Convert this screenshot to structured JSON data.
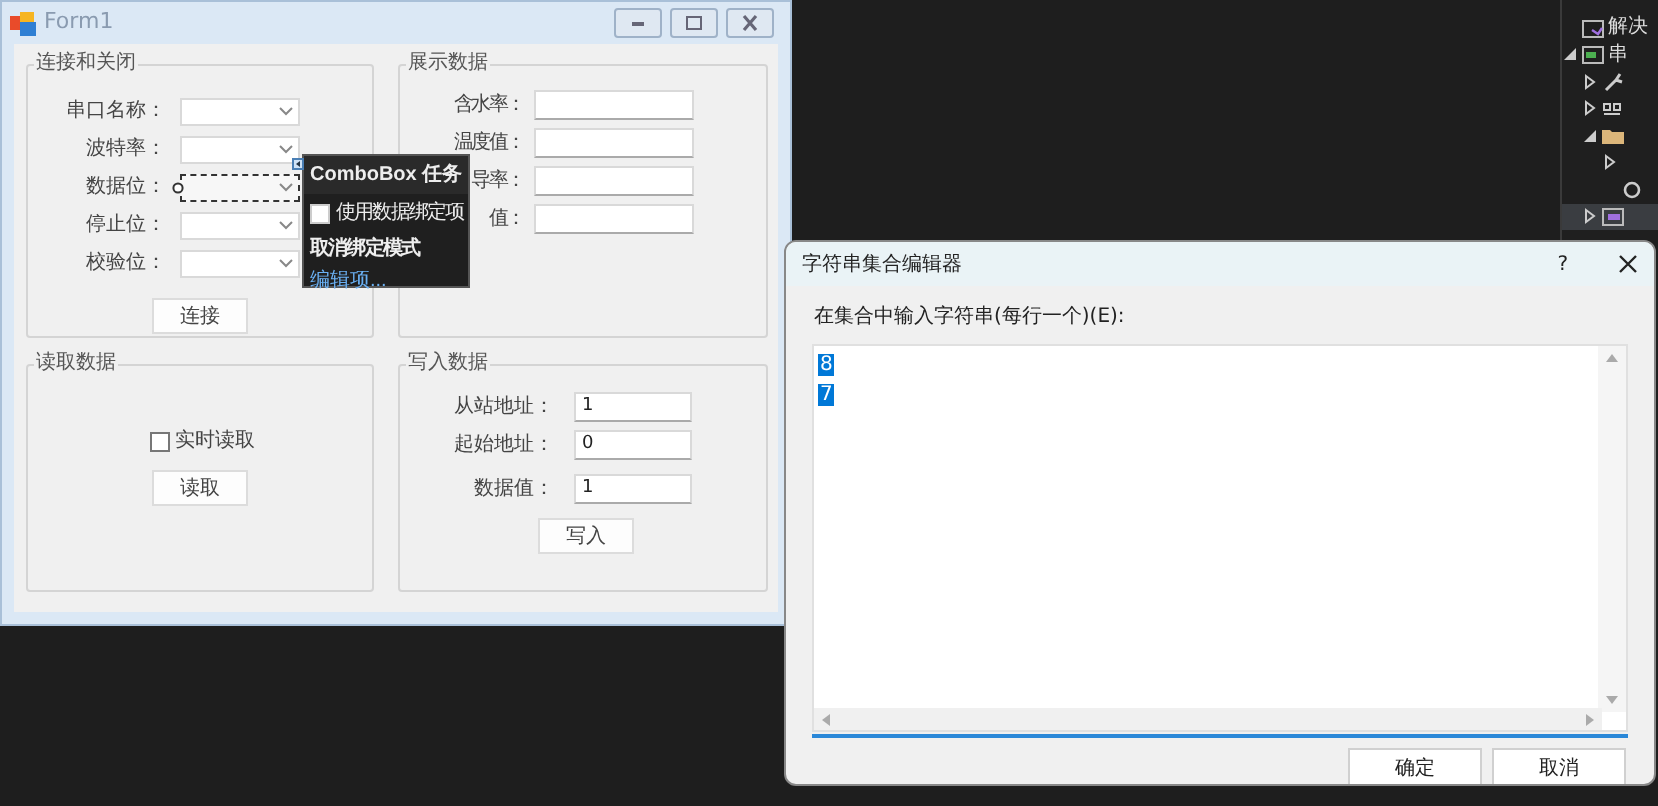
{
  "form": {
    "title": "Form1",
    "groups": [
      {
        "kind": "combos",
        "title": "连接和关闭",
        "fields": [
          {
            "label": "串口名称：",
            "selected": false
          },
          {
            "label": "波特率：",
            "selected": false
          },
          {
            "label": "数据位：",
            "selected": true
          },
          {
            "label": "停止位：",
            "selected": false
          },
          {
            "label": "校验位：",
            "selected": false
          }
        ],
        "button": "连接"
      },
      {
        "kind": "textboxes",
        "title": "展示数据",
        "fields": [
          {
            "label": "含水率："
          },
          {
            "label": "温度值："
          },
          {
            "label": "导率："
          },
          {
            "label": "值："
          }
        ]
      },
      {
        "kind": "read",
        "title": "读取数据",
        "checkbox": {
          "label": "实时读取",
          "checked": false
        },
        "button": "读取"
      },
      {
        "kind": "write",
        "title": "写入数据",
        "fields": [
          {
            "label": "从站地址：",
            "value": "1"
          },
          {
            "label": "起始地址：",
            "value": "0"
          },
          {
            "label": "数据值：",
            "value": "1"
          }
        ],
        "button": "写入"
      }
    ]
  },
  "task_panel": {
    "title": "ComboBox 任务",
    "checkbox": {
      "label": "使用数据绑定项",
      "checked": false
    },
    "action": "取消绑定模式",
    "link": "编辑项..."
  },
  "dialog": {
    "title": "字符串集合编辑器",
    "help": "?",
    "prompt": "在集合中输入字符串(每行一个)(E):",
    "lines": [
      {
        "text": "8",
        "selected": true
      },
      {
        "text": "7",
        "selected": true
      }
    ],
    "buttons": [
      "确定",
      "取消"
    ]
  },
  "ide": {
    "tree": [
      {
        "kind": "solution",
        "label": "解决"
      },
      {
        "kind": "project",
        "label": "串",
        "expanded": true,
        "children": [
          {
            "kind": "wrench",
            "expanded": false
          },
          {
            "kind": "references",
            "expanded": false
          },
          {
            "kind": "folder",
            "expanded": true,
            "children": [
              {
                "kind": "file",
                "expanded": false
              },
              {
                "kind": "settings"
              }
            ]
          },
          {
            "kind": "form",
            "expanded": false,
            "selected": true
          }
        ]
      }
    ]
  }
}
